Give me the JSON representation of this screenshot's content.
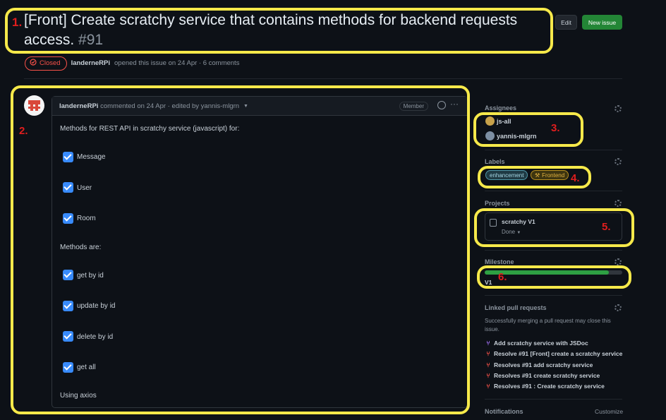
{
  "issue": {
    "title": "[Front] Create scratchy service that contains methods for backend requests access.",
    "number": "#91",
    "state": "Closed",
    "author": "landerneRPi",
    "opened_text": "opened this issue on 24 Apr · 6 comments"
  },
  "header_buttons": {
    "edit": "Edit",
    "new_issue": "New issue"
  },
  "comment": {
    "author": "landerneRPi",
    "meta": "commented on 24 Apr · edited by yannis-mlgrn",
    "role_badge": "Member",
    "intro": "Methods for REST API in scratchy service (javascript) for:",
    "tasks_1": [
      "Message",
      "User",
      "Room"
    ],
    "methods_heading": "Methods are:",
    "tasks_2": [
      "get by id",
      "update by id",
      "delete by id",
      "get all"
    ],
    "footer_text": "Using axios"
  },
  "sidebar": {
    "assignees": {
      "heading": "Assignees",
      "users": [
        "js-all",
        "yannis-mlgrn"
      ]
    },
    "labels": {
      "heading": "Labels",
      "items": [
        "enhancement",
        "Frontend"
      ]
    },
    "projects": {
      "heading": "Projects",
      "name": "scratchy V1",
      "status": "Done"
    },
    "milestone": {
      "heading": "Milestone",
      "name": "V1",
      "progress": 0.9
    },
    "linked_prs": {
      "heading": "Linked pull requests",
      "description": "Successfully merging a pull request may close this issue.",
      "items": [
        "Add scratchy service with JSDoc",
        "Resolve #91 [Front] create a scratchy service",
        "Resolves #91 add scratchy service",
        "Resolves #91 create scratchy service",
        "Resolves #91 : Create scratchy service"
      ]
    },
    "notifications": {
      "heading": "Notifications",
      "customize": "Customize"
    }
  },
  "annotations": [
    "1.",
    "2.",
    "3.",
    "4.",
    "5.",
    "6."
  ],
  "colors": {
    "accent_green": "#238636",
    "closed_red": "#f85149",
    "checkbox_blue": "#388bfd",
    "highlight_yellow": "#f6e94a",
    "annotation_red": "#e01e1e"
  }
}
